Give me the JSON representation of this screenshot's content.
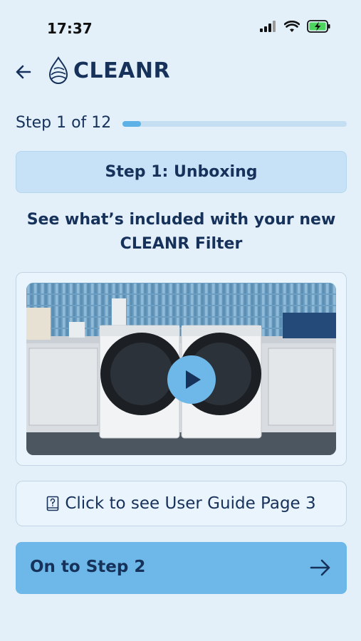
{
  "status_bar": {
    "time": "17:37",
    "icons": [
      "signal-icon",
      "wifi-icon",
      "battery-charging-icon"
    ]
  },
  "header": {
    "back_icon": "back-arrow-icon",
    "logo_icon": "water-drop-logo-icon",
    "brand": "CLEANR"
  },
  "progress": {
    "label": "Step 1 of 12",
    "current_step": 1,
    "total_steps": 12,
    "fraction": 0.083
  },
  "step": {
    "title": "Step 1: Unboxing",
    "description": "See what’s included with your new CLEANR Filter"
  },
  "video": {
    "thumbnail": "laundry-room-washer-dryer-image",
    "play_icon": "play-icon"
  },
  "guide_link": {
    "icon": "guide-book-icon",
    "label": "Click to see User Guide Page 3"
  },
  "next": {
    "label": "On to Step 2",
    "icon": "arrow-right-icon"
  },
  "colors": {
    "background": "#e3f0fa",
    "primary_text": "#16315a",
    "accent": "#6db8e8",
    "progress_fill": "#5eb1e6",
    "banner": "#c7e2f6"
  }
}
